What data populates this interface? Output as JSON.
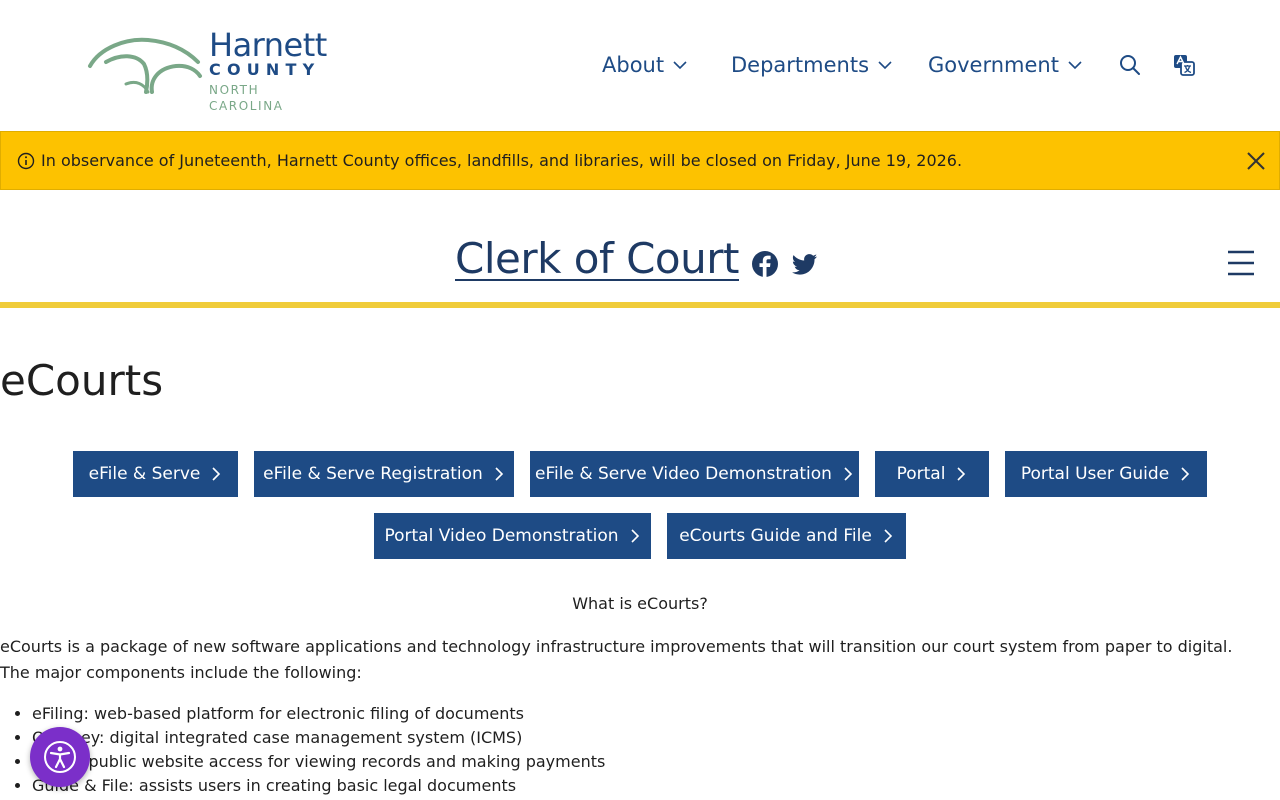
{
  "logo": {
    "name": "Harnett",
    "county": "COUNTY",
    "state": "NORTH CAROLINA"
  },
  "nav": {
    "items": [
      {
        "label": "About"
      },
      {
        "label": "Departments"
      },
      {
        "label": "Government"
      }
    ],
    "search_icon": "search-icon",
    "translate_icon": "translate-icon"
  },
  "alert": {
    "text": "In observance of Juneteenth, Harnett County offices, landfills, and libraries, will be closed on Friday, June 19, 2026.",
    "color": "#fdc200"
  },
  "department": {
    "title": "Clerk of Court",
    "social": [
      "facebook-icon",
      "twitter-icon"
    ]
  },
  "page": {
    "title": "eCourts"
  },
  "buttons": [
    {
      "label": "eFile & Serve"
    },
    {
      "label": "eFile & Serve Registration"
    },
    {
      "label": "eFile & Serve Video Demonstration"
    },
    {
      "label": "Portal"
    },
    {
      "label": "Portal User Guide"
    },
    {
      "label": "Portal Video Demonstration"
    },
    {
      "label": "eCourts Guide and File"
    }
  ],
  "content": {
    "heading": "What is eCourts?",
    "intro": "eCourts is a package of new software applications and technology infrastructure improvements that will transition our court system from paper to digital. The major components include the following:",
    "list": [
      "eFiling: web-based platform for electronic filing of documents",
      "Odyssey: digital integrated case management system (ICMS)",
      "Portal: public website access for viewing records and making payments",
      "Guide & File: assists users in creating basic legal documents"
    ]
  },
  "colors": {
    "brand_blue": "#1e4b85",
    "accent_yellow": "#f0cc3a",
    "a11y_purple": "#7b2fc9"
  }
}
